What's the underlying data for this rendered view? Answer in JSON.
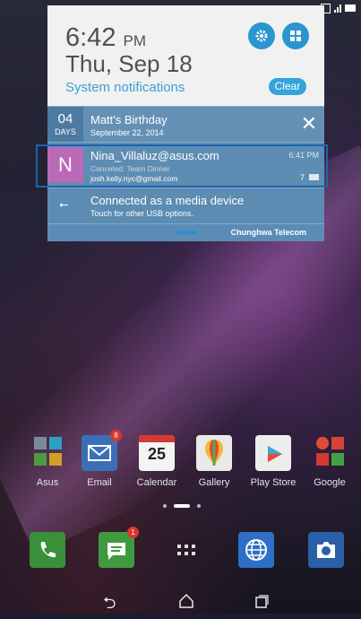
{
  "notification_panel": {
    "time": "6:42",
    "ampm": "PM",
    "date": "Thu, Sep 18",
    "system_notifications_label": "System notifications",
    "clear_label": "Clear",
    "notifications": {
      "birthday": {
        "day_count": "04",
        "day_unit": "DAYS",
        "title": "Matt's Birthday",
        "subtitle": "September 22, 2014",
        "close_label": "✕"
      },
      "email": {
        "avatar_letter": "N",
        "from": "Nina_Villaluz@asus.com",
        "subject": "Canceled: Team Dinner",
        "to": "josh.kelly.nyc@gmail.com",
        "time": "6:41 PM",
        "count": "7"
      },
      "usb": {
        "title": "Connected as a media device",
        "subtitle": "Touch for other USB options."
      }
    },
    "carrier": "Chunghwa Telecom"
  },
  "home": {
    "apps": [
      {
        "label": "Asus"
      },
      {
        "label": "Email",
        "badge": "8"
      },
      {
        "label": "Calendar",
        "day": "25"
      },
      {
        "label": "Gallery"
      },
      {
        "label": "Play Store"
      },
      {
        "label": "Google"
      }
    ],
    "dock": {
      "messaging_badge": "1"
    }
  },
  "colors": {
    "accent": "#2b95cf",
    "notification_bg": "#5f8fb5",
    "selection_border": "#1c64ad",
    "email_avatar": "#b969b8"
  },
  "icons": [
    "gear-icon",
    "grid-icon",
    "close-icon",
    "usb-icon",
    "mail-icon",
    "phone-icon",
    "messaging-icon",
    "app-drawer-icon",
    "browser-icon",
    "camera-icon",
    "back-icon",
    "home-icon",
    "recents-icon"
  ]
}
